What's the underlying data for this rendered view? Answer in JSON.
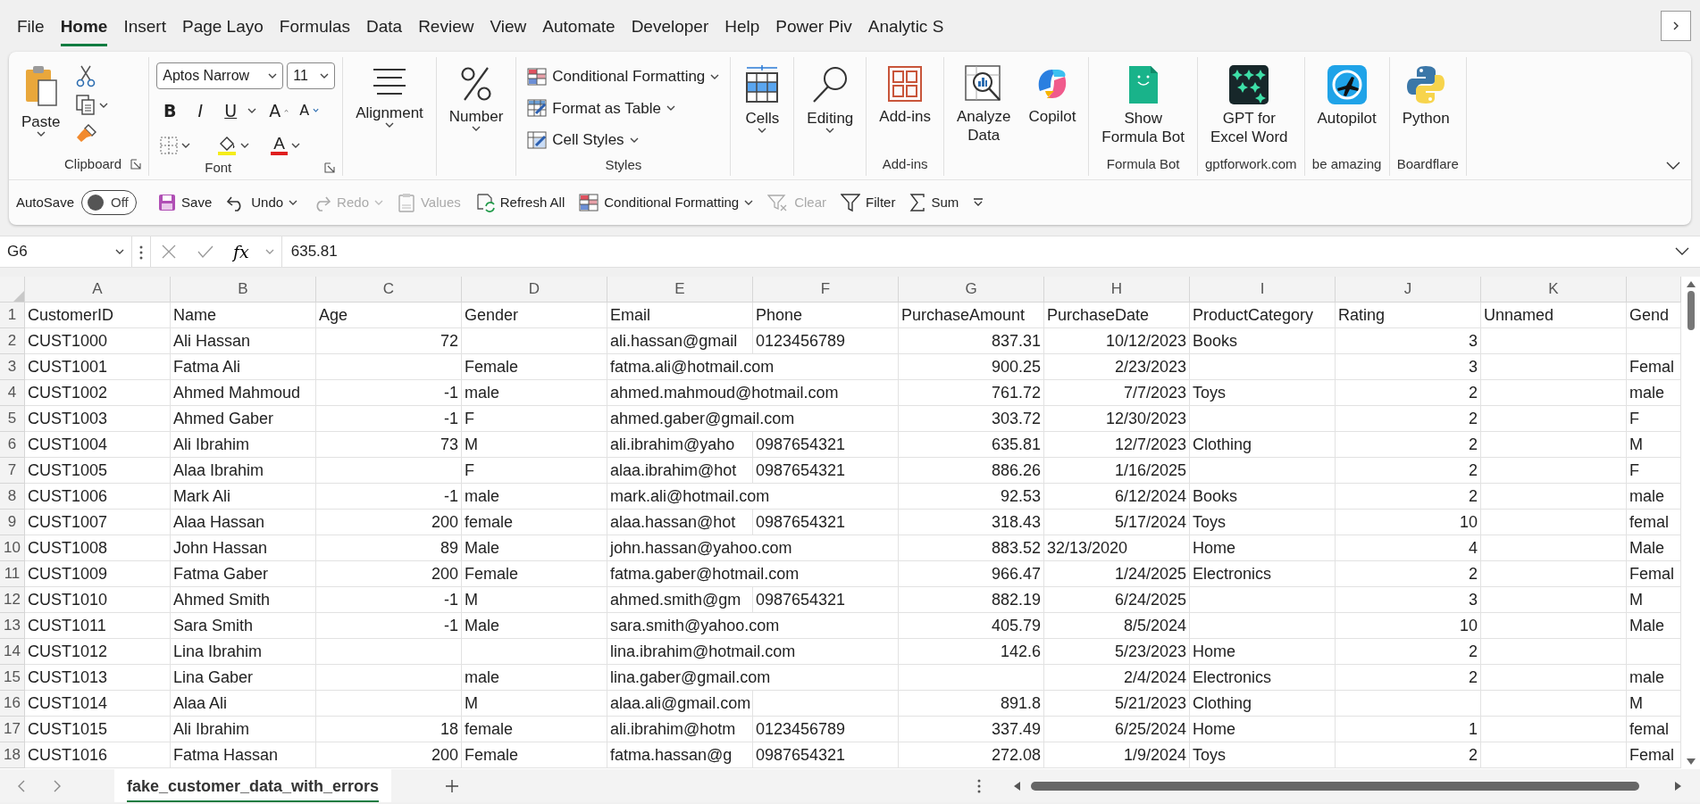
{
  "menu_tabs": [
    {
      "label": "File",
      "selected": false
    },
    {
      "label": "Home",
      "selected": true
    },
    {
      "label": "Insert",
      "selected": false
    },
    {
      "label": "Page Layo",
      "selected": false
    },
    {
      "label": "Formulas",
      "selected": false
    },
    {
      "label": "Data",
      "selected": false
    },
    {
      "label": "Review",
      "selected": false
    },
    {
      "label": "View",
      "selected": false
    },
    {
      "label": "Automate",
      "selected": false
    },
    {
      "label": "Developer",
      "selected": false
    },
    {
      "label": "Help",
      "selected": false
    },
    {
      "label": "Power Piv",
      "selected": false
    },
    {
      "label": "Analytic S",
      "selected": false
    }
  ],
  "ribbon": [
    {
      "kind": "clipboard",
      "label": "Clipboard",
      "launcher": true,
      "paste": "Paste"
    },
    {
      "kind": "font",
      "label": "Font",
      "launcher": true,
      "font_name": "Aptos Narrow",
      "font_size": "11",
      "styles": [
        "B",
        "I",
        "U"
      ],
      "grow": "A",
      "shrink": "A",
      "font_color": "A"
    },
    {
      "kind": "big",
      "buttons": [
        {
          "label": "Alignment",
          "dropdown": true
        }
      ]
    },
    {
      "kind": "big",
      "buttons": [
        {
          "label": "Number",
          "dropdown": true
        }
      ]
    },
    {
      "kind": "list",
      "label": "Styles",
      "buttons": [
        {
          "label": "Conditional Formatting",
          "dropdown": true
        },
        {
          "label": "Format as Table",
          "dropdown": true
        },
        {
          "label": "Cell Styles",
          "dropdown": true
        }
      ]
    },
    {
      "kind": "big",
      "buttons": [
        {
          "label": "Cells",
          "dropdown": true
        }
      ]
    },
    {
      "kind": "big",
      "buttons": [
        {
          "label": "Editing",
          "dropdown": true
        }
      ]
    },
    {
      "kind": "big",
      "label": "Add-ins",
      "buttons": [
        {
          "label": "Add-ins"
        }
      ]
    },
    {
      "kind": "big",
      "buttons": [
        {
          "label": "Analyze\nData"
        },
        {
          "label": "Copilot"
        }
      ]
    },
    {
      "kind": "big",
      "label": "Formula Bot",
      "buttons": [
        {
          "label": "Show\nFormula Bot"
        }
      ]
    },
    {
      "kind": "big",
      "label": "gptforwork.com",
      "buttons": [
        {
          "label": "GPT for\nExcel Word"
        }
      ]
    },
    {
      "kind": "big",
      "label": "be amazing",
      "buttons": [
        {
          "label": "Autopilot"
        }
      ]
    },
    {
      "kind": "big",
      "label": "Boardflare",
      "buttons": [
        {
          "label": "Python"
        }
      ]
    }
  ],
  "quick": [
    {
      "kind": "label",
      "label": "AutoSave"
    },
    {
      "kind": "toggle",
      "label": "Off",
      "on": false
    },
    {
      "kind": "button",
      "label": "Save",
      "disabled": false
    },
    {
      "kind": "button",
      "label": "Undo",
      "dropdown": true,
      "disabled": false
    },
    {
      "kind": "button",
      "label": "Redo",
      "dropdown": true,
      "disabled": true
    },
    {
      "kind": "button",
      "label": "Values",
      "disabled": true
    },
    {
      "kind": "button",
      "label": "Refresh All",
      "disabled": false
    },
    {
      "kind": "button",
      "label": "Conditional Formatting",
      "dropdown": true,
      "disabled": false
    },
    {
      "kind": "button",
      "label": "Clear",
      "disabled": true
    },
    {
      "kind": "button",
      "label": "Filter",
      "disabled": false
    },
    {
      "kind": "button",
      "label": "Sum",
      "disabled": false
    },
    {
      "kind": "more"
    }
  ],
  "formula_bar": {
    "name_box": "G6",
    "function_label": "fx",
    "formula": "635.81"
  },
  "sheet": {
    "columns": [
      {
        "letter": "A",
        "kind": "text"
      },
      {
        "letter": "B",
        "kind": "text"
      },
      {
        "letter": "C",
        "kind": "number"
      },
      {
        "letter": "D",
        "kind": "text"
      },
      {
        "letter": "E",
        "kind": "text"
      },
      {
        "letter": "F",
        "kind": "text"
      },
      {
        "letter": "G",
        "kind": "number"
      },
      {
        "letter": "H",
        "kind": "number"
      },
      {
        "letter": "I",
        "kind": "text"
      },
      {
        "letter": "J",
        "kind": "number"
      },
      {
        "letter": "K",
        "kind": "text"
      },
      {
        "kind": "text"
      }
    ],
    "header_row": {
      "number": "1",
      "cells": [
        "CustomerID",
        "Name",
        "Age",
        "Gender",
        "Email",
        "Phone",
        "PurchaseAmount",
        "PurchaseDate",
        "ProductCategory",
        "Rating",
        "Unnamed",
        "Gend"
      ]
    },
    "rows": [
      {
        "number": "2",
        "cells": [
          "CUST1000",
          "Ali Hassan",
          "72",
          null,
          "ali.hassan@gmail",
          "0123456789",
          "837.31",
          "10/12/2023",
          "Books",
          "3",
          null,
          null
        ]
      },
      {
        "number": "3",
        "cells": [
          "CUST1001",
          "Fatma Ali",
          null,
          "Female",
          "fatma.ali@hotmail.com",
          null,
          "900.25",
          "2/23/2023",
          null,
          "3",
          null,
          "Femal"
        ]
      },
      {
        "number": "4",
        "cells": [
          "CUST1002",
          "Ahmed Mahmoud",
          "-1",
          "male",
          "ahmed.mahmoud@hotmail.com",
          null,
          "761.72",
          "7/7/2023",
          "Toys",
          "2",
          null,
          "male"
        ]
      },
      {
        "number": "5",
        "cells": [
          "CUST1003",
          "Ahmed Gaber",
          "-1",
          "F",
          "ahmed.gaber@gmail.com",
          null,
          "303.72",
          "12/30/2023",
          null,
          "2",
          null,
          "F"
        ]
      },
      {
        "number": "6",
        "cells": [
          "CUST1004",
          "Ali Ibrahim",
          "73",
          "M",
          "ali.ibrahim@yaho",
          "0987654321",
          "635.81",
          "12/7/2023",
          "Clothing",
          "2",
          null,
          "M"
        ]
      },
      {
        "number": "7",
        "cells": [
          "CUST1005",
          "Alaa Ibrahim",
          null,
          "F",
          "alaa.ibrahim@hot",
          "0987654321",
          "886.26",
          "1/16/2025",
          null,
          "2",
          null,
          "F"
        ]
      },
      {
        "number": "8",
        "cells": [
          "CUST1006",
          "Mark Ali",
          "-1",
          "male",
          "mark.ali@hotmail.com",
          null,
          "92.53",
          "6/12/2024",
          "Books",
          "2",
          null,
          "male"
        ]
      },
      {
        "number": "9",
        "cells": [
          "CUST1007",
          "Alaa Hassan",
          "200",
          "female",
          "alaa.hassan@hot",
          "0987654321",
          "318.43",
          "5/17/2024",
          "Toys",
          "10",
          null,
          "femal"
        ]
      },
      {
        "number": "10",
        "cells": [
          "CUST1008",
          "John Hassan",
          "89",
          "Male",
          "john.hassan@yahoo.com",
          null,
          "883.52",
          {
            "text": "32/13/2020",
            "kind": "text"
          },
          "Home",
          "4",
          null,
          "Male"
        ]
      },
      {
        "number": "11",
        "cells": [
          "CUST1009",
          "Fatma Gaber",
          "200",
          "Female",
          "fatma.gaber@hotmail.com",
          null,
          "966.47",
          "1/24/2025",
          "Electronics",
          "2",
          null,
          "Femal"
        ]
      },
      {
        "number": "12",
        "cells": [
          "CUST1010",
          "Ahmed Smith",
          "-1",
          "M",
          "ahmed.smith@gm",
          "0987654321",
          "882.19",
          "6/24/2025",
          null,
          "3",
          null,
          "M"
        ]
      },
      {
        "number": "13",
        "cells": [
          "CUST1011",
          "Sara Smith",
          "-1",
          "Male",
          "sara.smith@yahoo.com",
          null,
          "405.79",
          "8/5/2024",
          null,
          "10",
          null,
          "Male"
        ]
      },
      {
        "number": "14",
        "cells": [
          "CUST1012",
          "Lina Ibrahim",
          null,
          null,
          "lina.ibrahim@hotmail.com",
          null,
          "142.6",
          "5/23/2023",
          "Home",
          "2",
          null,
          null
        ]
      },
      {
        "number": "15",
        "cells": [
          "CUST1013",
          "Lina Gaber",
          null,
          "male",
          "lina.gaber@gmail.com",
          null,
          null,
          "2/4/2024",
          "Electronics",
          "2",
          null,
          "male"
        ]
      },
      {
        "number": "16",
        "cells": [
          "CUST1014",
          "Alaa Ali",
          null,
          "M",
          "alaa.ali@gmail.com",
          null,
          "891.8",
          "5/21/2023",
          "Clothing",
          null,
          null,
          "M"
        ]
      },
      {
        "number": "17",
        "cells": [
          "CUST1015",
          "Ali Ibrahim",
          "18",
          "female",
          "ali.ibrahim@hotm",
          "0123456789",
          "337.49",
          "6/25/2024",
          "Home",
          "1",
          null,
          "femal"
        ]
      },
      {
        "number": "18",
        "cells": [
          "CUST1016",
          "Fatma Hassan",
          "200",
          "Female",
          "fatma.hassan@g",
          "0987654321",
          "272.08",
          "1/9/2024",
          "Toys",
          "2",
          null,
          "Femal"
        ]
      }
    ]
  },
  "sheet_tabs": [
    {
      "label": "fake_customer_data_with_errors",
      "selected": true
    }
  ]
}
